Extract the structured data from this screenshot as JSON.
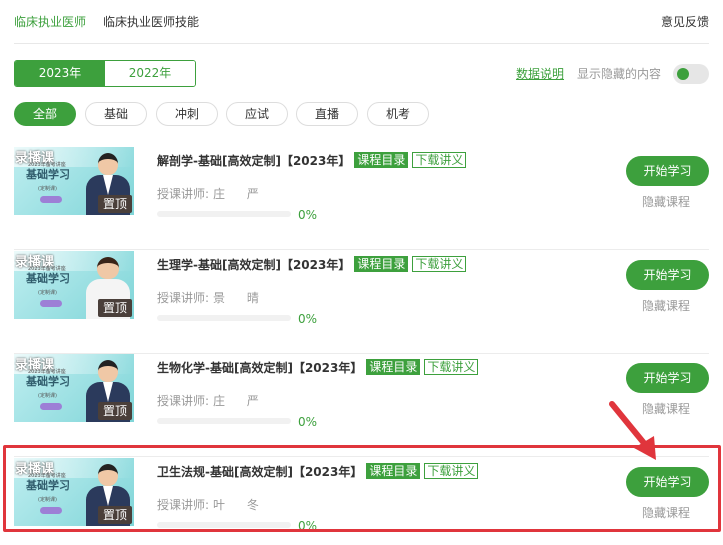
{
  "top_tabs": [
    {
      "label": "临床执业医师",
      "active": true
    },
    {
      "label": "临床执业医师技能",
      "active": false
    }
  ],
  "feedback_label": "意见反馈",
  "years": [
    {
      "label": "2023年",
      "active": true
    },
    {
      "label": "2022年",
      "active": false
    }
  ],
  "data_link": "数据说明",
  "show_hidden_label": "显示隐藏的内容",
  "show_hidden_on": false,
  "categories": [
    {
      "label": "全部",
      "active": true
    },
    {
      "label": "基础",
      "active": false
    },
    {
      "label": "冲刺",
      "active": false
    },
    {
      "label": "应试",
      "active": false
    },
    {
      "label": "直播",
      "active": false
    },
    {
      "label": "机考",
      "active": false
    }
  ],
  "courses": [
    {
      "title": "解剖学-基础[高效定制]【2023年】",
      "catalog": "课程目录",
      "download": "下载讲义",
      "teacher_label": "授课讲师:",
      "teacher": "庄 严",
      "progress": "0%",
      "progress_value": 0,
      "start": "开始学习",
      "hide": "隐藏课程",
      "thumb": {
        "rec": "录播课",
        "sub": "2023年备考讲座",
        "big": "基础学习",
        "tag": "(定制课)",
        "pin": "置顶"
      }
    },
    {
      "title": "生理学-基础[高效定制]【2023年】",
      "catalog": "课程目录",
      "download": "下载讲义",
      "teacher_label": "授课讲师:",
      "teacher": "景 晴",
      "progress": "0%",
      "progress_value": 0,
      "start": "开始学习",
      "hide": "隐藏课程",
      "thumb": {
        "rec": "录播课",
        "sub": "2023年备考讲座",
        "big": "基础学习",
        "tag": "(定制课)",
        "pin": "置顶"
      }
    },
    {
      "title": "生物化学-基础[高效定制]【2023年】",
      "catalog": "课程目录",
      "download": "下载讲义",
      "teacher_label": "授课讲师:",
      "teacher": "庄 严",
      "progress": "0%",
      "progress_value": 0,
      "start": "开始学习",
      "hide": "隐藏课程",
      "thumb": {
        "rec": "录播课",
        "sub": "2023年备考讲座",
        "big": "基础学习",
        "tag": "(定制课)",
        "pin": "置顶"
      }
    },
    {
      "title": "卫生法规-基础[高效定制]【2023年】",
      "catalog": "课程目录",
      "download": "下载讲义",
      "teacher_label": "授课讲师:",
      "teacher": "叶 冬",
      "progress": "0%",
      "progress_value": 0,
      "start": "开始学习",
      "hide": "隐藏课程",
      "thumb": {
        "rec": "录播课",
        "sub": "2023年备考讲座",
        "big": "基础学习",
        "tag": "(定制课)",
        "pin": "置顶"
      }
    }
  ],
  "colors": {
    "accent": "#3da03d",
    "highlight": "#e0353c"
  }
}
